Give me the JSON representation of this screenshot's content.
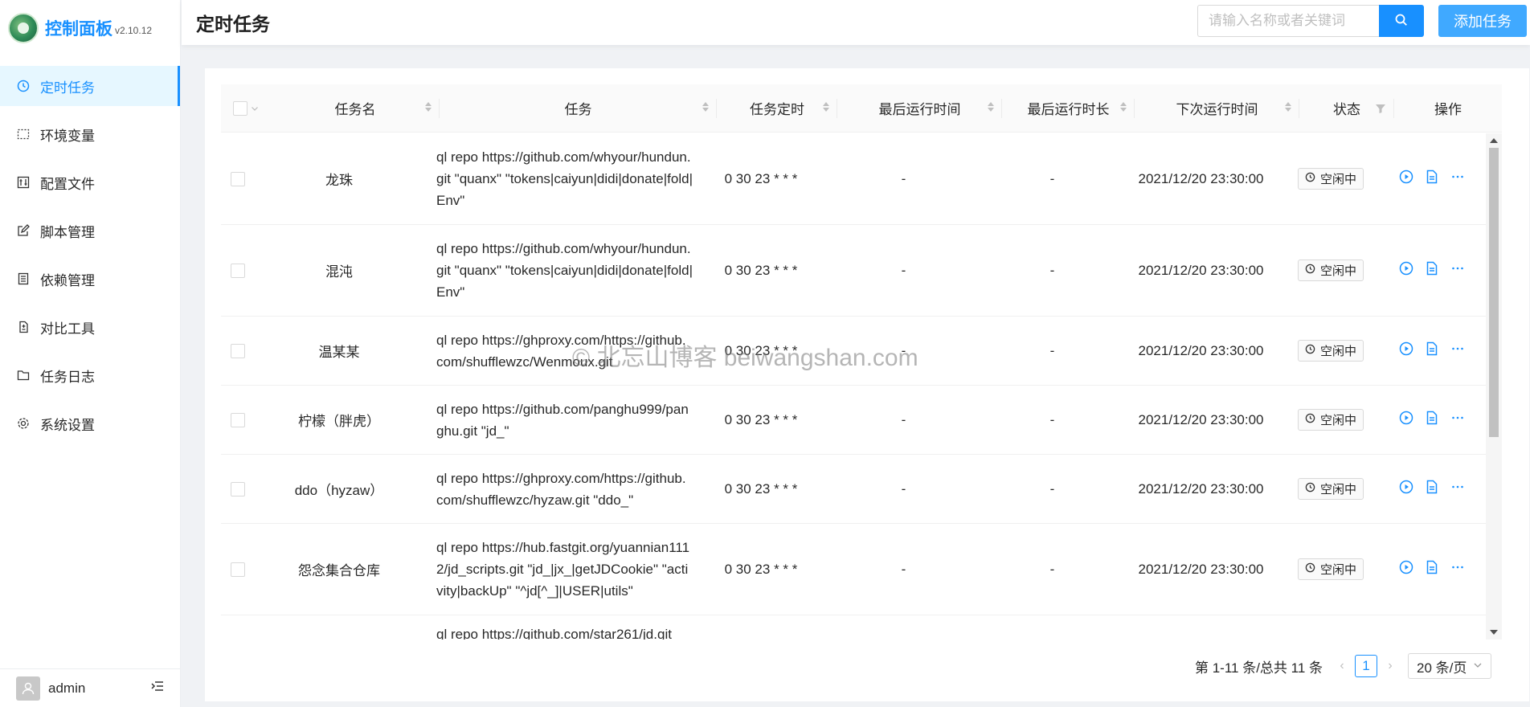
{
  "app": {
    "name": "控制面板",
    "version": "v2.10.12"
  },
  "sidebar": {
    "items": [
      {
        "label": "定时任务",
        "icon": "clock-icon",
        "active": true
      },
      {
        "label": "环境变量",
        "icon": "variable-icon",
        "active": false
      },
      {
        "label": "配置文件",
        "icon": "control-icon",
        "active": false
      },
      {
        "label": "脚本管理",
        "icon": "edit-icon",
        "active": false
      },
      {
        "label": "依赖管理",
        "icon": "container-icon",
        "active": false
      },
      {
        "label": "对比工具",
        "icon": "diff-icon",
        "active": false
      },
      {
        "label": "任务日志",
        "icon": "folder-icon",
        "active": false
      },
      {
        "label": "系统设置",
        "icon": "setting-icon",
        "active": false
      }
    ],
    "footer": {
      "username": "admin"
    }
  },
  "header": {
    "title": "定时任务",
    "search_placeholder": "请输入名称或者关键词",
    "add_label": "添加任务"
  },
  "table": {
    "columns": [
      "任务名",
      "任务",
      "任务定时",
      "最后运行时间",
      "最后运行时长",
      "下次运行时间",
      "状态",
      "操作"
    ],
    "rows": [
      {
        "name": "龙珠",
        "task": "ql repo https://github.com/whyour/hundun.git \"quanx\" \"tokens|caiyun|didi|donate|fold|Env\"",
        "cron": "0 30 23 * * *",
        "last_run": "-",
        "duration": "-",
        "next_run": "2021/12/20 23:30:00",
        "status": "空闲中"
      },
      {
        "name": "混沌",
        "task": "ql repo https://github.com/whyour/hundun.git \"quanx\" \"tokens|caiyun|didi|donate|fold|Env\"",
        "cron": "0 30 23 * * *",
        "last_run": "-",
        "duration": "-",
        "next_run": "2021/12/20 23:30:00",
        "status": "空闲中"
      },
      {
        "name": "温某某",
        "task": "ql repo https://ghproxy.com/https://github.com/shufflewzc/Wenmoux.git",
        "cron": "0 30 23 * * *",
        "last_run": "-",
        "duration": "-",
        "next_run": "2021/12/20 23:30:00",
        "status": "空闲中"
      },
      {
        "name": "柠檬（胖虎）",
        "task": "ql repo https://github.com/panghu999/panghu.git \"jd_\"",
        "cron": "0 30 23 * * *",
        "last_run": "-",
        "duration": "-",
        "next_run": "2021/12/20 23:30:00",
        "status": "空闲中"
      },
      {
        "name": "ddo（hyzaw）",
        "task": "ql repo https://ghproxy.com/https://github.com/shufflewzc/hyzaw.git \"ddo_\"",
        "cron": "0 30 23 * * *",
        "last_run": "-",
        "duration": "-",
        "next_run": "2021/12/20 23:30:00",
        "status": "空闲中"
      },
      {
        "name": "怨念集合仓库",
        "task": "ql repo https://hub.fastgit.org/yuannian1112/jd_scripts.git \"jd_|jx_|getJDCookie\" \"activity|backUp\" \"^jd[^_]|USER|utils\"",
        "cron": "0 30 23 * * *",
        "last_run": "-",
        "duration": "-",
        "next_run": "2021/12/20 23:30:00",
        "status": "空闲中"
      },
      {
        "name": "",
        "task": "ql repo https://github.com/star261/jd.git",
        "cron": "",
        "last_run": "",
        "duration": "",
        "next_run": "",
        "status": ""
      }
    ]
  },
  "pagination": {
    "summary": "第 1-11 条/总共 11 条",
    "current": "1",
    "page_size": "20 条/页"
  },
  "watermark": "© 北忘山博客 beiwangshan.com",
  "colors": {
    "primary": "#1890ff",
    "add_button": "#40a9ff",
    "sidebar_active_bg": "#e6f7ff"
  }
}
